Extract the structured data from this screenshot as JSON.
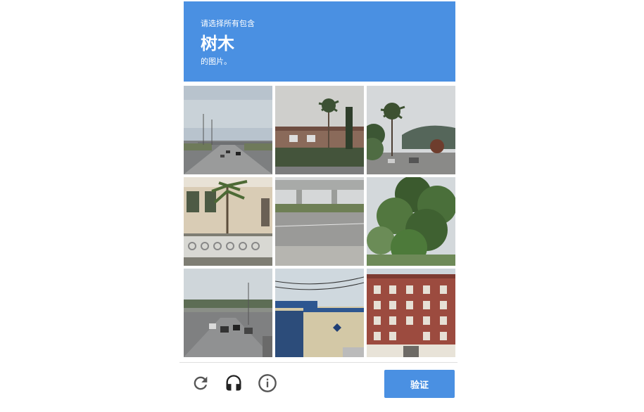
{
  "challenge": {
    "prompt": "请选择所有包含",
    "target": "树木",
    "suffix": "的图片。"
  },
  "tiles": [
    {
      "id": 1,
      "scene": "highway with overpass"
    },
    {
      "id": 2,
      "scene": "palm trees and building"
    },
    {
      "id": 3,
      "scene": "palm tree street with hills"
    },
    {
      "id": 4,
      "scene": "house with palm and fence"
    },
    {
      "id": 5,
      "scene": "overpass and road"
    },
    {
      "id": 6,
      "scene": "trees"
    },
    {
      "id": 7,
      "scene": "freeway traffic under bridge"
    },
    {
      "id": 8,
      "scene": "building with power lines"
    },
    {
      "id": 9,
      "scene": "brick apartment building"
    }
  ],
  "footer": {
    "verify_label": "验证",
    "icons": [
      "reload-icon",
      "headphones-icon",
      "info-icon"
    ]
  },
  "colors": {
    "accent": "#4a90e2",
    "icon": "#555555"
  }
}
